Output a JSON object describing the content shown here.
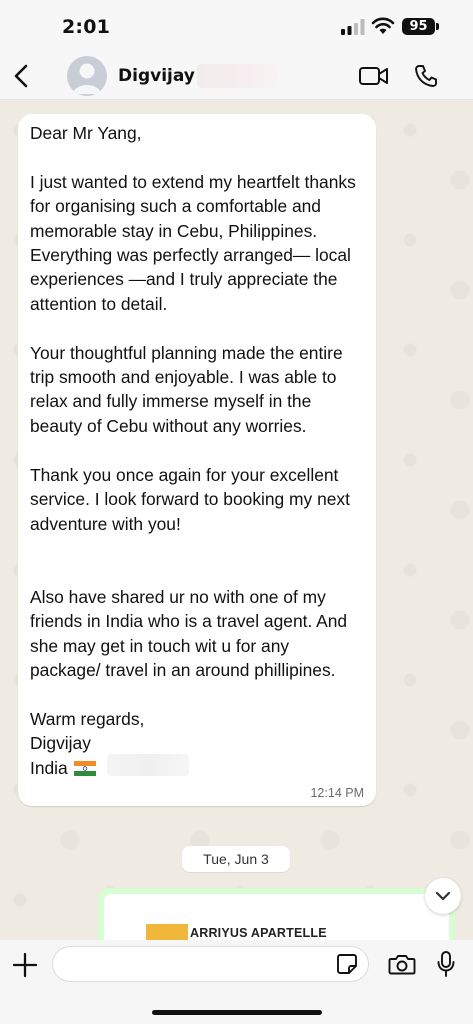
{
  "status_bar": {
    "time": "2:01",
    "battery": "95"
  },
  "header": {
    "contact_name": "Digvijay"
  },
  "message": {
    "text": "Dear Mr Yang,\n\nI just wanted to extend my heartfelt thanks for organising such a comfortable and memorable stay in Cebu, Philippines. Everything was perfectly arranged— local experiences —and I truly appreciate the attention to detail.\n\nYour thoughtful planning made the entire trip smooth and enjoyable. I was able to relax and fully immerse myself in the beauty of Cebu without any worries.\n\nThank you once again for your excellent service. I look forward to booking my next adventure with you!\n\n\nAlso have shared ur no with one of my friends in India who is a travel agent. And she may get in touch wit u for any package/ travel in an around phillipines.\n\nWarm regards,\nDigvijay",
    "country": "India",
    "time": "12:14 PM"
  },
  "date_separator": "Tue, Jun 3",
  "outgoing_card": {
    "title": "ARRIYUS APARTELLE"
  },
  "composer": {
    "placeholder": ""
  },
  "colors": {
    "outgoing_bubble": "#d9fdd3",
    "chat_background": "#efeae2"
  },
  "icons": [
    "back-icon",
    "avatar-icon",
    "video-call-icon",
    "phone-icon",
    "chevron-down-icon",
    "plus-icon",
    "sticker-icon",
    "camera-icon",
    "mic-icon"
  ]
}
